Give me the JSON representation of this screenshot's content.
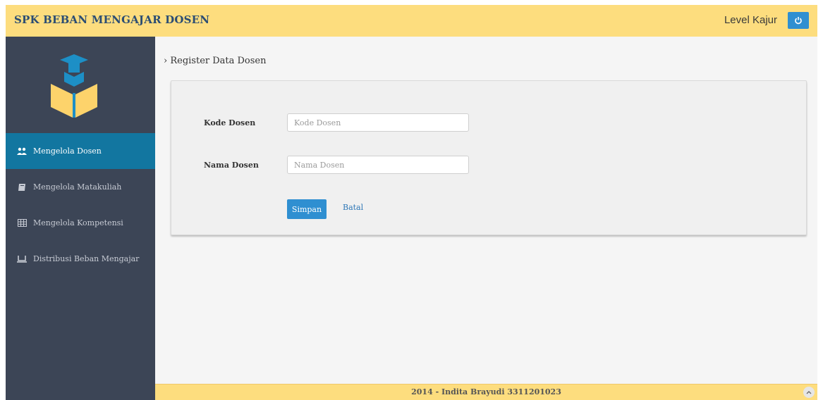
{
  "header": {
    "brand": "SPK BEBAN MENGAJAR DOSEN",
    "level_text": "Level Kajur",
    "power_icon": "power-icon"
  },
  "sidebar": {
    "logo_icon": "graduation-box-icon",
    "items": [
      {
        "label": "Mengelola Dosen",
        "icon": "users-icon",
        "active": true
      },
      {
        "label": "Mengelola Matakuliah",
        "icon": "book-icon",
        "active": false
      },
      {
        "label": "Mengelola Kompetensi",
        "icon": "table-icon",
        "active": false
      },
      {
        "label": "Distribusi Beban Mengajar",
        "icon": "laptop-icon",
        "active": false
      }
    ]
  },
  "main": {
    "breadcrumb": "› Register Data Dosen",
    "form": {
      "kode_label": "Kode Dosen",
      "kode_placeholder": "Kode Dosen",
      "kode_value": "",
      "nama_label": "Nama Dosen",
      "nama_placeholder": "Nama Dosen",
      "nama_value": "",
      "save_label": "Simpan",
      "cancel_label": "Batal"
    }
  },
  "footer": {
    "text": "2014 - Indita Brayudi 3311201023"
  },
  "colors": {
    "topbar": "#fddd7e",
    "sidebar": "#3c4556",
    "active_item": "#1276a0",
    "primary_button": "#2f8fd1",
    "brand_text": "#2b4d73"
  }
}
